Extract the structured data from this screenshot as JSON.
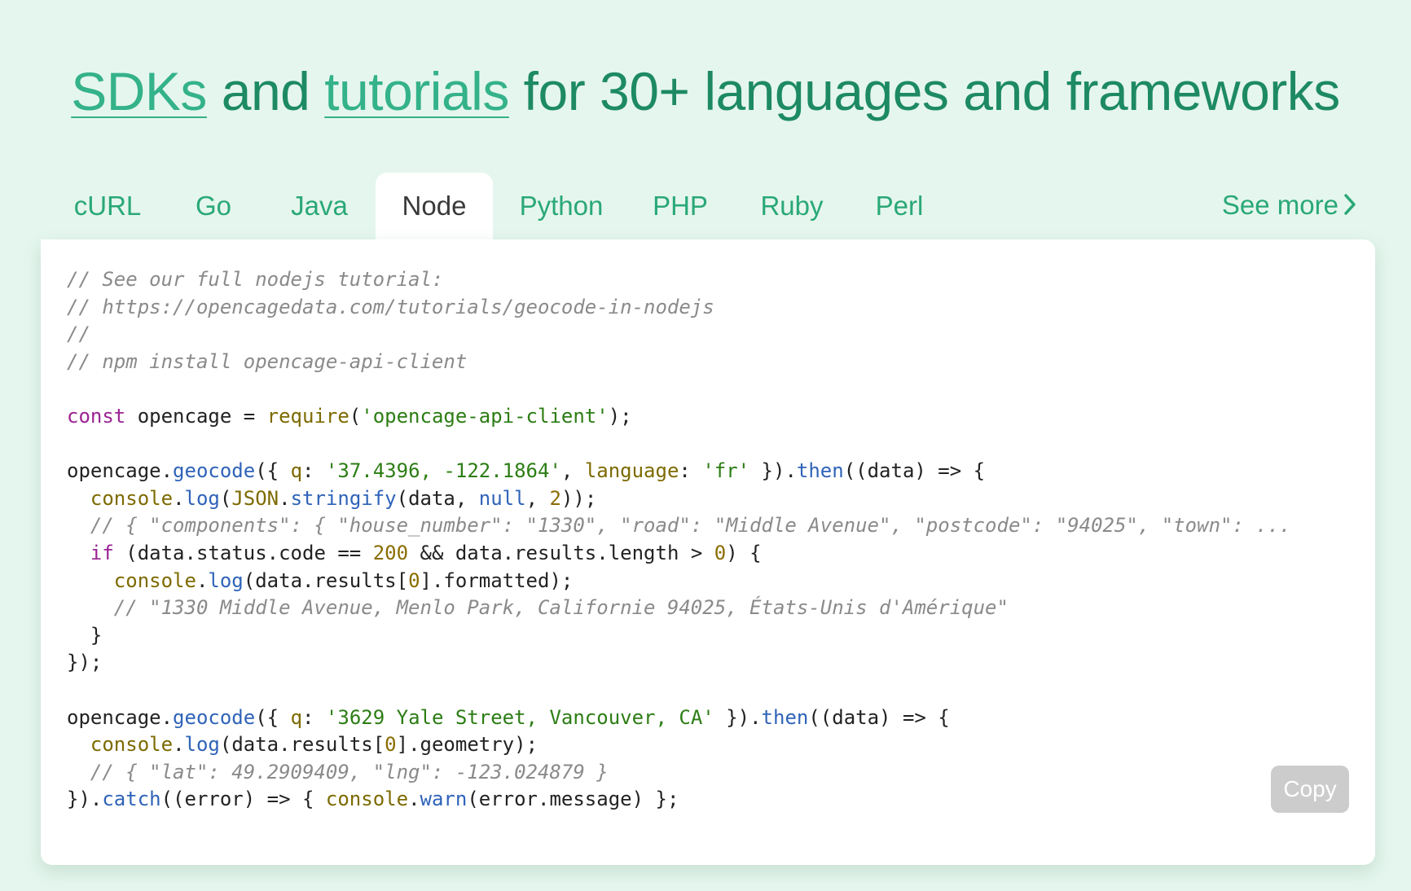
{
  "headline": {
    "link_sdks": "SDKs",
    "text_and": " and ",
    "link_tutorials": "tutorials",
    "text_rest": " for 30+ languages and frameworks"
  },
  "tabs": [
    {
      "label": "cURL"
    },
    {
      "label": "Go"
    },
    {
      "label": "Java"
    },
    {
      "label": "Node"
    },
    {
      "label": "Python"
    },
    {
      "label": "PHP"
    },
    {
      "label": "Ruby"
    },
    {
      "label": "Perl"
    }
  ],
  "active_tab": "Node",
  "see_more": "See more",
  "copy_button": "Copy",
  "colors": {
    "background": "#e5f6ee",
    "accent": "#2aa878",
    "headline": "#1d8a63"
  },
  "code": {
    "l1": "// See our full nodejs tutorial:",
    "l2": "// https://opencagedata.com/tutorials/geocode-in-nodejs",
    "l3": "//",
    "l4": "// npm install opencage-api-client",
    "l6": {
      "kw": "const",
      "t1": " opencage = ",
      "fn": "require",
      "t2": "(",
      "str": "'opencage-api-client'",
      "t3": ");"
    },
    "l8": {
      "t1": "opencage.",
      "m1": "geocode",
      "t2": "({ ",
      "p1": "q",
      "t3": ": ",
      "s1": "'37.4396, -122.1864'",
      "t4": ", ",
      "p2": "language",
      "t5": ": ",
      "s2": "'fr'",
      "t6": " }).",
      "m2": "then",
      "t7": "((data) => {"
    },
    "l9": {
      "ind": "  ",
      "fn": "console",
      "t1": ".",
      "m1": "log",
      "t2": "(",
      "fn2": "JSON",
      "t3": ".",
      "m2": "stringify",
      "t4": "(data, ",
      "kw": "null",
      "t5": ", ",
      "n1": "2",
      "t6": "));"
    },
    "l10": "  // { \"components\": { \"house_number\": \"1330\", \"road\": \"Middle Avenue\", \"postcode\": \"94025\", \"town\": ...",
    "l11": {
      "ind": "  ",
      "kw": "if",
      "t1": " (data.status.code == ",
      "n1": "200",
      "t2": " && data.results.length > ",
      "n2": "0",
      "t3": ") {"
    },
    "l12": {
      "ind": "    ",
      "fn": "console",
      "t1": ".",
      "m1": "log",
      "t2": "(data.results[",
      "n1": "0",
      "t3": "].formatted);"
    },
    "l13": "    // \"1330 Middle Avenue, Menlo Park, Californie 94025, États-Unis d'Amérique\"",
    "l14": "  }",
    "l15": "});",
    "l17": {
      "t1": "opencage.",
      "m1": "geocode",
      "t2": "({ ",
      "p1": "q",
      "t3": ": ",
      "s1": "'3629 Yale Street, Vancouver, CA'",
      "t4": " }).",
      "m2": "then",
      "t5": "((data) => {"
    },
    "l18": {
      "ind": "  ",
      "fn": "console",
      "t1": ".",
      "m1": "log",
      "t2": "(data.results[",
      "n1": "0",
      "t3": "].geometry);"
    },
    "l19": "  // { \"lat\": 49.2909409, \"lng\": -123.024879 }",
    "l20": {
      "t1": "}).",
      "m1": "catch",
      "t2": "((error) => { ",
      "fn": "console",
      "t3": ".",
      "m2": "warn",
      "t4": "(error.message) };"
    }
  }
}
